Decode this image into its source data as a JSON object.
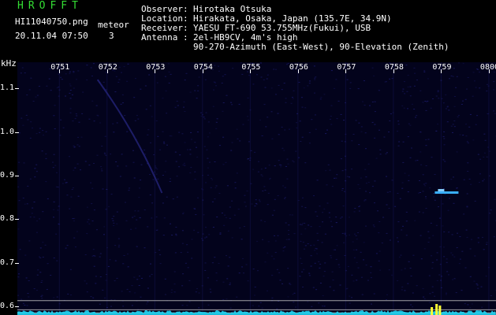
{
  "header": {
    "app_logo": "HROFFT",
    "file_name": "HI11040750.png",
    "date_time": "20.11.04 07:50",
    "detection_type": "meteor",
    "detection_count": "3"
  },
  "station_info": {
    "observer": {
      "label": "Observer",
      "value": "Hirotaka Otsuka"
    },
    "location": {
      "label": "Location",
      "value": "Hirakata, Osaka, Japan (135.7E, 34.9N)"
    },
    "receiver": {
      "label": "Receiver",
      "value": "YAESU FT-690 53.755MHz(Fukui), USB"
    },
    "antenna": {
      "label": "Antenna",
      "value": "2el-HB9CV, 4m's high"
    },
    "antenna_orientation": "90-270-Azimuth (East-West), 90-Elevation (Zenith)"
  },
  "axes": {
    "y_unit": "kHz",
    "y_ticks": [
      "1.1",
      "1.0",
      "0.9",
      "0.8",
      "0.7",
      "0.6"
    ],
    "y_tick_values": [
      1.1,
      1.0,
      0.9,
      0.8,
      0.7,
      0.6
    ],
    "y_range": [
      0.58,
      1.16
    ],
    "x_ticks": [
      "0751",
      "0752",
      "0753",
      "0754",
      "0755",
      "0756",
      "0757",
      "0758",
      "0759",
      "0800"
    ],
    "x_tick_minutes": [
      1,
      2,
      3,
      4,
      5,
      6,
      7,
      8,
      9,
      10
    ],
    "x_range_minutes": [
      0.12,
      10.15
    ]
  },
  "colors": {
    "background": "#000000",
    "plot_background": "#03031c",
    "noise": "#1c1c6a",
    "echo": "#3ab0ff",
    "baseline_spectrum": "#1ee0ff",
    "alert_bars": "#ffff33",
    "logo": "#33dd33",
    "reference_lines": "#c9c9c9"
  },
  "meteor_echo": {
    "time_minutes": 9.0,
    "frequency_khz": 0.86
  }
}
